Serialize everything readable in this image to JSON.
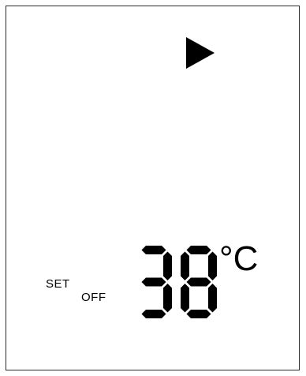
{
  "display": {
    "set_label": "SET",
    "off_label": "OFF",
    "temperature": "38",
    "unit": "°C",
    "indicator_icon": "play-arrow-icon"
  },
  "colors": {
    "segment": "#000000",
    "background": "#ffffff",
    "border": "#2a2a2a"
  }
}
